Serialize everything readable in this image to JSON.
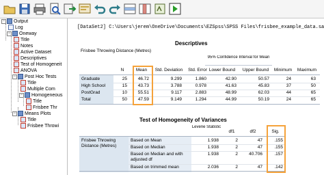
{
  "toolbar": {
    "icons": [
      "open-icon",
      "save-icon",
      "print-icon",
      "print-preview-icon",
      "export-icon",
      "recall-dialog-icon",
      "undo-icon",
      "redo-icon",
      "goto-case-icon",
      "goto-variable-icon",
      "variables-icon",
      "designate-window-icon"
    ]
  },
  "outline": {
    "items": [
      {
        "label": "Output"
      },
      {
        "label": "Log"
      },
      {
        "label": "Oneway"
      },
      {
        "label": "Title"
      },
      {
        "label": "Notes"
      },
      {
        "label": "Active Dataset"
      },
      {
        "label": "Descriptives"
      },
      {
        "label": "Test of Homogeneit"
      },
      {
        "label": "ANOVA"
      },
      {
        "label": "Post Hoc Tests"
      },
      {
        "label": "Title"
      },
      {
        "label": "Multiple Com"
      },
      {
        "label": "Homogeneous"
      },
      {
        "label": "Title"
      },
      {
        "label": "Frisbee Thr"
      },
      {
        "label": "Means Plots"
      },
      {
        "label": "Title"
      },
      {
        "label": "Frisbee Throwi"
      }
    ]
  },
  "output": {
    "dataset_line": "[DataSet2] C:\\Users\\jerem\\OneDrive\\Documents\\EZSpss\\SPSS Files\\frisbee_example_data.sav",
    "descriptives": {
      "title": "Descriptives",
      "subtitle": "Frisbee Throwing Distance (Metres)",
      "ci_header": "95% Confidence Interval for Mean",
      "headers": [
        "N",
        "Mean",
        "Std. Deviation",
        "Std. Error",
        "Lower Bound",
        "Upper Bound",
        "Minimum",
        "Maximum"
      ],
      "rows": [
        {
          "label": "Graduate",
          "values": [
            "25",
            "46.72",
            "9.299",
            "1.860",
            "42.90",
            "50.57",
            "24",
            "63"
          ]
        },
        {
          "label": "High School",
          "values": [
            "15",
            "43.73",
            "3.788",
            "0.978",
            "41.63",
            "45.83",
            "37",
            "50"
          ]
        },
        {
          "label": "PostGrad",
          "values": [
            "10",
            "55.51",
            "9.117",
            "2.883",
            "48.99",
            "62.03",
            "44",
            "65"
          ]
        },
        {
          "label": "Total",
          "values": [
            "50",
            "47.59",
            "9.149",
            "1.294",
            "44.99",
            "50.19",
            "24",
            "65"
          ]
        }
      ]
    },
    "homogeneity": {
      "title": "Test of Homogeneity of Variances",
      "headers": [
        "Levene Statistic",
        "df1",
        "df2",
        "Sig."
      ],
      "row_label": "Frisbee Throwing Distance (Metres)",
      "rows": [
        {
          "label": "Based on Mean",
          "values": [
            "1.938",
            "2",
            "47",
            ".155"
          ]
        },
        {
          "label": "Based on Median",
          "values": [
            "1.938",
            "2",
            "47",
            ".155"
          ]
        },
        {
          "label": "Based on Median and with adjusted df",
          "values": [
            "1.938",
            "2",
            "40.706",
            ".157"
          ]
        },
        {
          "label": "Based on trimmed mean",
          "values": [
            "2.036",
            "2",
            "47",
            ".142"
          ]
        }
      ]
    }
  },
  "colors": {
    "row_header_bg": "#dce6f0",
    "highlight": "#f5a23a",
    "grid": "#a8b4c4"
  }
}
